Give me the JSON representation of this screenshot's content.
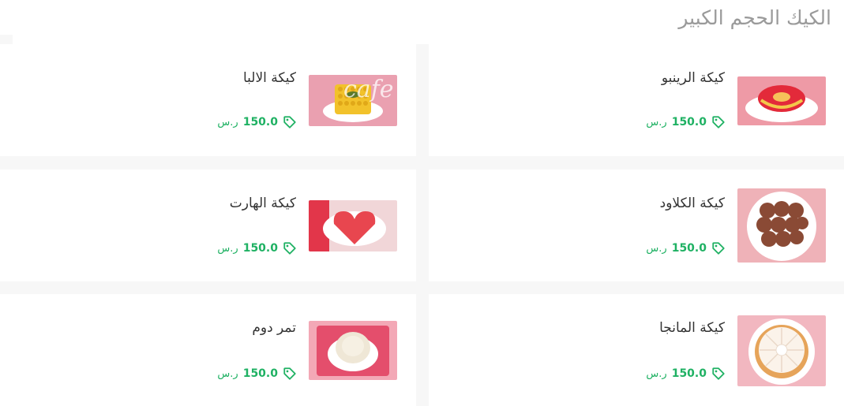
{
  "section": {
    "title": "الكيك الحجم الكبير"
  },
  "currency": "ر.س",
  "watermark": "cafe",
  "products": [
    {
      "name": "كيكة الرينبو",
      "price": "150.0",
      "image": "rainbow-cake-image"
    },
    {
      "name": "كيكة الالبا",
      "price": "150.0",
      "image": "alba-cake-image"
    },
    {
      "name": "كيكة الكلاود",
      "price": "150.0",
      "image": "cloud-cake-image"
    },
    {
      "name": "كيكة الهارت",
      "price": "150.0",
      "image": "heart-cake-image"
    },
    {
      "name": "كيكة المانجا",
      "price": "150.0",
      "image": "mango-cake-image"
    },
    {
      "name": "تمر دوم",
      "price": "150.0",
      "image": "tamr-dom-cake-image"
    }
  ],
  "colors": {
    "price": "#1fb163",
    "title": "#9a9a9a",
    "background": "#f7f7f7"
  }
}
